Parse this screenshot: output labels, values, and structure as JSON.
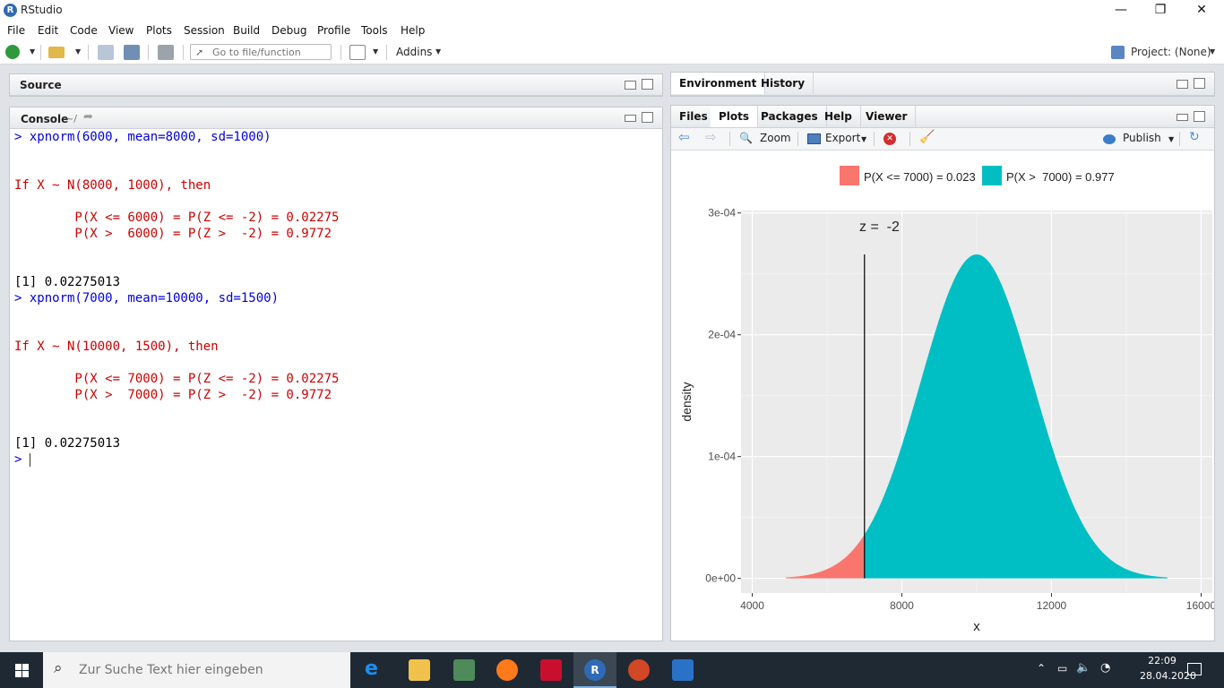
{
  "window": {
    "title": "RStudio",
    "logo_letter": "R",
    "minimize": "—",
    "maximize": "❐",
    "close": "✕"
  },
  "menu": [
    "File",
    "Edit",
    "Code",
    "View",
    "Plots",
    "Session",
    "Build",
    "Debug",
    "Profile",
    "Tools",
    "Help"
  ],
  "toolbar": {
    "goto_placeholder": "Go to file/function",
    "addins_label": "Addins",
    "project_label": "Project: (None)"
  },
  "source": {
    "tab_label": "Source"
  },
  "console": {
    "tab_label": "Console",
    "path": "~/",
    "lines": [
      {
        "text": "> xpnorm(6000, mean=8000, sd=1000)",
        "color": "blue"
      },
      {
        "text": "",
        "color": "black"
      },
      {
        "text": "",
        "color": "black"
      },
      {
        "text": "If X ~ N(8000, 1000), then",
        "color": "red"
      },
      {
        "text": "",
        "color": "black"
      },
      {
        "text": "        P(X <= 6000) = P(Z <= -2) = 0.02275",
        "color": "red"
      },
      {
        "text": "        P(X >  6000) = P(Z >  -2) = 0.9772",
        "color": "red"
      },
      {
        "text": "",
        "color": "black"
      },
      {
        "text": "",
        "color": "black"
      },
      {
        "text": "[1] 0.02275013",
        "color": "black"
      },
      {
        "text": "> xpnorm(7000, mean=10000, sd=1500)",
        "color": "blue"
      },
      {
        "text": "",
        "color": "black"
      },
      {
        "text": "",
        "color": "black"
      },
      {
        "text": "If X ~ N(10000, 1500), then",
        "color": "red"
      },
      {
        "text": "",
        "color": "black"
      },
      {
        "text": "        P(X <= 7000) = P(Z <= -2) = 0.02275",
        "color": "red"
      },
      {
        "text": "        P(X >  7000) = P(Z >  -2) = 0.9772",
        "color": "red"
      },
      {
        "text": "",
        "color": "black"
      },
      {
        "text": "",
        "color": "black"
      },
      {
        "text": "[1] 0.02275013",
        "color": "black"
      },
      {
        "text": "> ",
        "color": "blue"
      }
    ]
  },
  "env_panel": {
    "tabs": [
      "Environment",
      "History"
    ]
  },
  "files_panel": {
    "tabs": [
      "Files",
      "Plots",
      "Packages",
      "Help",
      "Viewer"
    ],
    "active_tab": "Plots",
    "zoom_label": "Zoom",
    "export_label": "Export",
    "publish_label": "Publish"
  },
  "chart_data": {
    "type": "area",
    "xlabel": "x",
    "ylabel": "density",
    "xlim": [
      3700,
      16300
    ],
    "ylim": [
      -1.2e-05,
      0.000302
    ],
    "x_ticks": [
      4000,
      8000,
      12000,
      16000
    ],
    "x_tick_labels": [
      "4000",
      "8000",
      "12000",
      "16000"
    ],
    "y_ticks": [
      0,
      0.0001,
      0.0002,
      0.0003
    ],
    "y_tick_labels": [
      "0e+00",
      "1e-04",
      "2e-04",
      "3e-04"
    ],
    "distribution": {
      "mean": 10000,
      "sd": 1500
    },
    "x_range": [
      4900,
      15100
    ],
    "cutoff": 7000,
    "annotation": "z =  -2",
    "annotation_x": 7400,
    "annotation_y": 0.000285,
    "grid": true,
    "legend_position": "top",
    "series": [
      {
        "name": "P(X <= 7000) = 0.023",
        "color": "#f8766d",
        "region": "lower"
      },
      {
        "name": "P(X >  7000) = 0.977",
        "color": "#00bfc4",
        "region": "upper"
      }
    ]
  },
  "taskbar": {
    "search_placeholder": "Zur Suche Text hier eingeben",
    "time": "22:09",
    "date": "28.04.2020"
  }
}
